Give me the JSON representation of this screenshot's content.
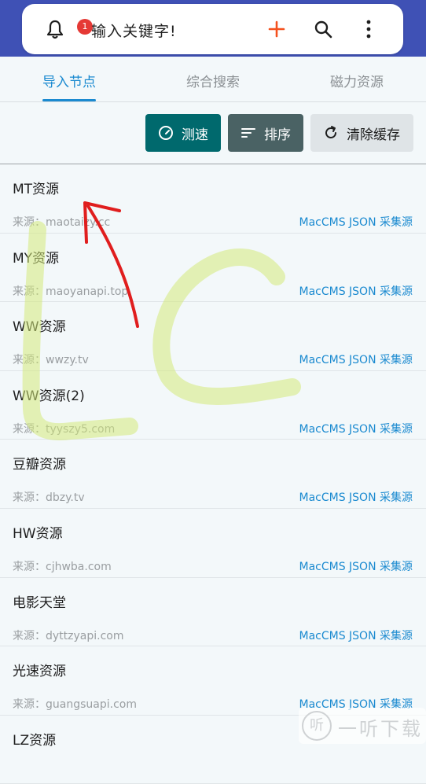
{
  "header": {
    "notification_count": "1",
    "search_placeholder": "输入关键字!"
  },
  "tabs": [
    {
      "label": "导入节点",
      "active": true
    },
    {
      "label": "综合搜索",
      "active": false
    },
    {
      "label": "磁力资源",
      "active": false
    }
  ],
  "toolbar": {
    "speed_label": "测速",
    "sort_label": "排序",
    "clear_label": "清除缓存"
  },
  "sources": [
    {
      "title": "MT资源",
      "source": "来源：maotaizy.cc",
      "type": "MacCMS JSON 采集源"
    },
    {
      "title": "MY资源",
      "source": "来源：maoyanapi.top",
      "type": "MacCMS JSON 采集源"
    },
    {
      "title": "WW资源",
      "source": "来源：wwzy.tv",
      "type": "MacCMS JSON 采集源"
    },
    {
      "title": "WW资源(2)",
      "source": "来源：tyyszy5.com",
      "type": "MacCMS JSON 采集源"
    },
    {
      "title": "豆瓣资源",
      "source": "来源：dbzy.tv",
      "type": "MacCMS JSON 采集源"
    },
    {
      "title": "HW资源",
      "source": "来源：cjhwba.com",
      "type": "MacCMS JSON 采集源"
    },
    {
      "title": "电影天堂",
      "source": "来源：dyttzyapi.com",
      "type": "MacCMS JSON 采集源"
    },
    {
      "title": "光速资源",
      "source": "来源：guangsuapi.com",
      "type": "MacCMS JSON 采集源"
    },
    {
      "title": "LZ资源",
      "source": "",
      "type": ""
    }
  ],
  "watermark": {
    "text": "一听下载",
    "icon_glyph": "听"
  },
  "colors": {
    "header_band": "#3f51b5",
    "accent_blue": "#1b8ad0",
    "speed_button": "#00696d",
    "sort_button": "#4a6264",
    "badge": "#e53935",
    "add_icon": "#f4511e"
  }
}
